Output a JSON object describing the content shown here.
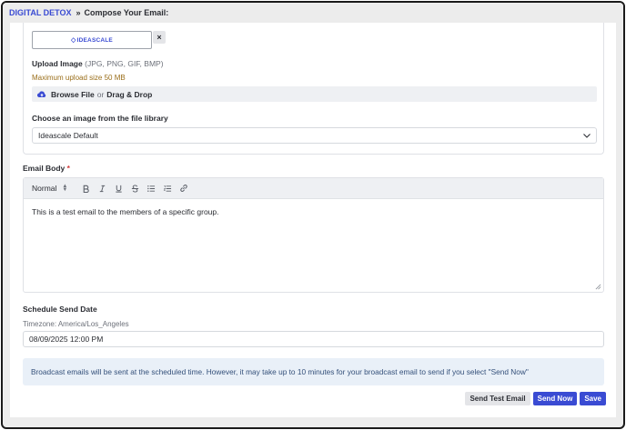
{
  "breadcrumb": {
    "root": "DIGITAL DETOX",
    "separator": "»",
    "current": "Compose Your Email:"
  },
  "image_section": {
    "logo_text": "IDEASCALE",
    "remove_symbol": "×",
    "upload_label": "Upload Image",
    "upload_types": "(JPG, PNG, GIF, BMP)",
    "max_size": "Maximum upload size 50 MB",
    "browse_label": "Browse File",
    "or_text": "or",
    "drag_label": "Drag & Drop",
    "library_label": "Choose an image from the file library",
    "library_selected": "Ideascale Default"
  },
  "email_body": {
    "label": "Email Body",
    "required_mark": "*",
    "format_value": "Normal",
    "content": "This is a test email to the members of a specific group."
  },
  "schedule": {
    "label": "Schedule Send Date",
    "timezone": "Timezone: America/Los_Angeles",
    "datetime_value": "08/09/2025 12:00 PM"
  },
  "info_message": "Broadcast emails will be sent at the scheduled time. However, it may take up to 10 minutes for your broadcast email to send if you select \"Send Now\"",
  "actions": {
    "send_test": "Send Test Email",
    "send_now": "Send Now",
    "save": "Save"
  },
  "colors": {
    "accent": "#3a4bd3",
    "warning_text": "#9a6e1a",
    "info_bg": "#e9f0f8",
    "required": "#d13a3a"
  },
  "icons": [
    "cloud-upload-icon",
    "chevron-down-icon",
    "bold-icon",
    "italic-icon",
    "underline-icon",
    "strikethrough-icon",
    "bullet-list-icon",
    "ordered-list-icon",
    "link-icon",
    "resize-grip-icon"
  ]
}
